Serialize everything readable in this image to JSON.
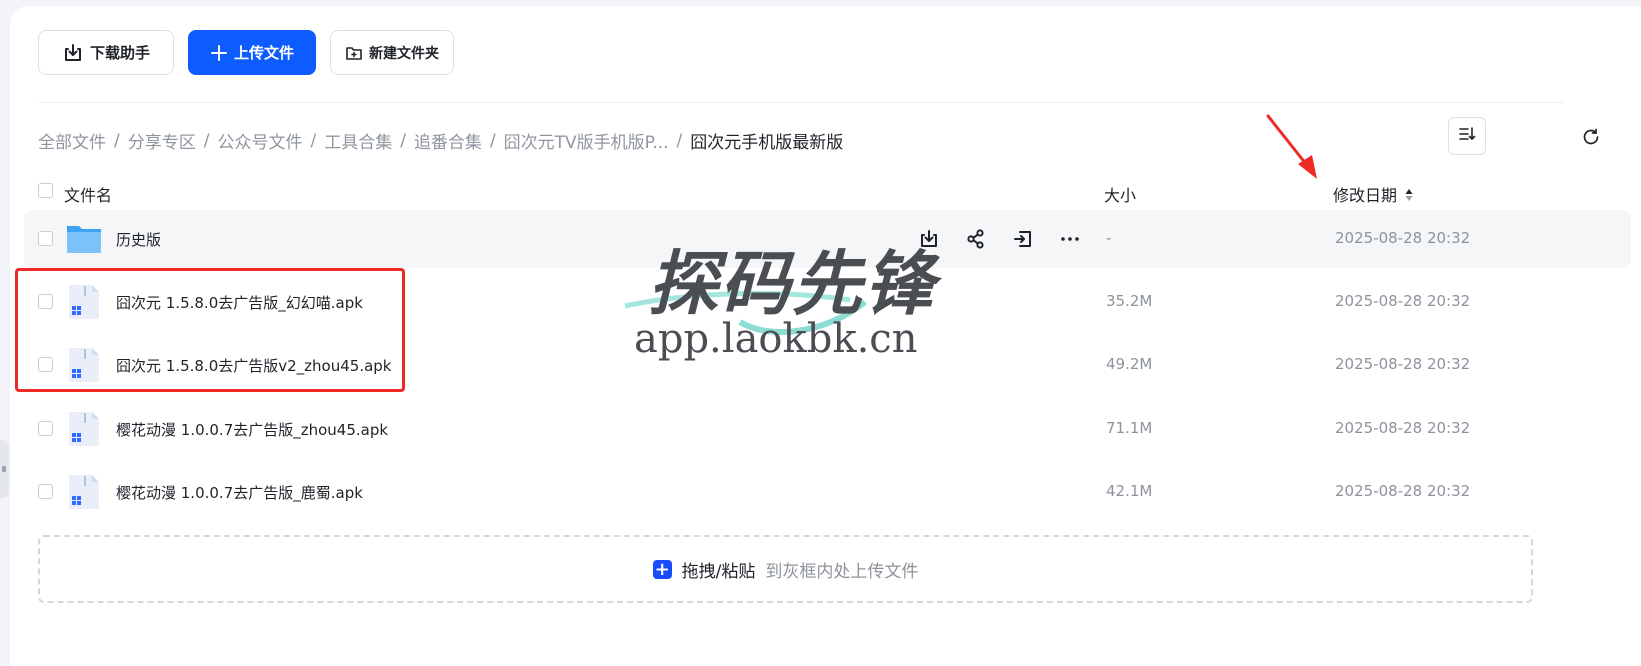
{
  "toolbar": {
    "download_helper_label": "下载助手",
    "upload_label": "上传文件",
    "new_folder_label": "新建文件夹"
  },
  "breadcrumb": {
    "items": [
      "全部文件",
      "分享专区",
      "公众号文件",
      "工具合集",
      "追番合集",
      "囧次元TV版手机版P..."
    ],
    "separator": "/",
    "current": "囧次元手机版最新版"
  },
  "table": {
    "headers": {
      "name": "文件名",
      "size": "大小",
      "modified": "修改日期"
    },
    "rows": [
      {
        "name": "历史版",
        "type": "folder",
        "size": "-",
        "date": "2025-08-28 20:32"
      },
      {
        "name": "囧次元 1.5.8.0去广告版_幻幻喵.apk",
        "type": "apk",
        "size": "35.2M",
        "date": "2025-08-28 20:32"
      },
      {
        "name": "囧次元 1.5.8.0去广告版v2_zhou45.apk",
        "type": "apk",
        "size": "49.2M",
        "date": "2025-08-28 20:32"
      },
      {
        "name": "樱花动漫 1.0.0.7去广告版_zhou45.apk",
        "type": "apk",
        "size": "71.1M",
        "date": "2025-08-28 20:32"
      },
      {
        "name": "樱花动漫 1.0.0.7去广告版_鹿蜀.apk",
        "type": "apk",
        "size": "42.1M",
        "date": "2025-08-28 20:32"
      }
    ]
  },
  "row_actions": [
    "download-icon",
    "share-icon",
    "move-icon",
    "more-icon"
  ],
  "dropzone": {
    "primary": "拖拽/粘贴",
    "secondary": "到灰框内处上传文件"
  },
  "watermark": {
    "title": "探码先锋",
    "url": "app.laokbk.cn"
  },
  "colors": {
    "primary": "#0c5cff",
    "annotation": "#ee2a24",
    "muted": "#8d939c"
  }
}
